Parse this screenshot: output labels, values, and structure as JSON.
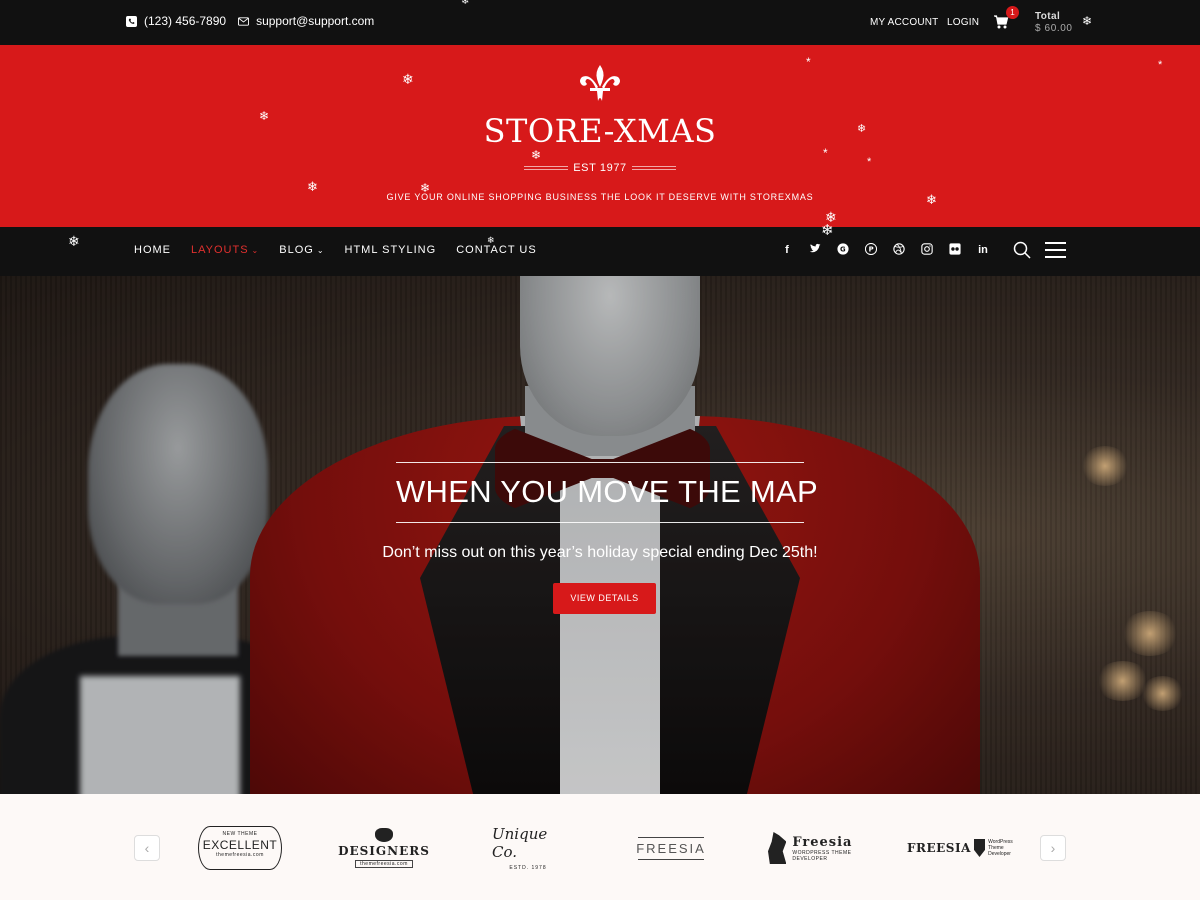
{
  "topbar": {
    "phone": "(123) 456-7890",
    "email": "support@support.com",
    "my_account": "MY ACCOUNT",
    "login": "LOGIN",
    "cart_count": "1",
    "total_label": "Total",
    "total_amount": "$ 60.00",
    "icons": [
      "phone-icon",
      "mail-icon",
      "cart-icon"
    ]
  },
  "header": {
    "logo_icon": "fleur-de-lis",
    "site_title": "STORE-XMAS",
    "est": "EST 1977",
    "tagline": "GIVE YOUR ONLINE SHOPPING BUSINESS THE LOOK IT DESERVE WITH STOREXMAS",
    "background_color": "#d7191a"
  },
  "nav": {
    "items": [
      {
        "label": "HOME",
        "active": false,
        "dropdown": false
      },
      {
        "label": "LAYOUTS",
        "active": true,
        "dropdown": true
      },
      {
        "label": "BLOG",
        "active": false,
        "dropdown": true
      },
      {
        "label": "HTML STYLING",
        "active": false,
        "dropdown": false
      },
      {
        "label": "CONTACT US",
        "active": false,
        "dropdown": false
      }
    ],
    "social": [
      {
        "name": "facebook",
        "glyph": "f"
      },
      {
        "name": "twitter",
        "glyph": "t"
      },
      {
        "name": "google-plus",
        "glyph": "G"
      },
      {
        "name": "pinterest",
        "glyph": "P"
      },
      {
        "name": "dribbble",
        "glyph": "◎"
      },
      {
        "name": "instagram",
        "glyph": "◻"
      },
      {
        "name": "flickr",
        "glyph": "●●"
      },
      {
        "name": "linkedin",
        "glyph": "in"
      }
    ],
    "active_color": "#e0302e"
  },
  "hero": {
    "title": "WHEN YOU MOVE THE MAP",
    "subtitle": "Don’t miss out on this year’s holiday special ending Dec 25th!",
    "button": "VIEW DETAILS"
  },
  "brands": {
    "prev": "‹",
    "next": "›",
    "logos": [
      {
        "name": "excellent",
        "small": "NEW THEME",
        "word": "EXCELLENT",
        "sub": "themefreesia.com"
      },
      {
        "name": "designers",
        "word": "DESIGNERS",
        "sub": "themefreesia.com"
      },
      {
        "name": "unique-co",
        "word": "Unique Co.",
        "sub": "ESTD.   1978"
      },
      {
        "name": "freesia-lines",
        "word": "FREESIA"
      },
      {
        "name": "freesia-lion",
        "word": "Freesia",
        "sub": "WORDPRESS THEME DEVELOPER"
      },
      {
        "name": "freesia-shield",
        "word": "FREESIA",
        "sub1": "WordPress",
        "sub2": "Theme Developer"
      }
    ]
  }
}
